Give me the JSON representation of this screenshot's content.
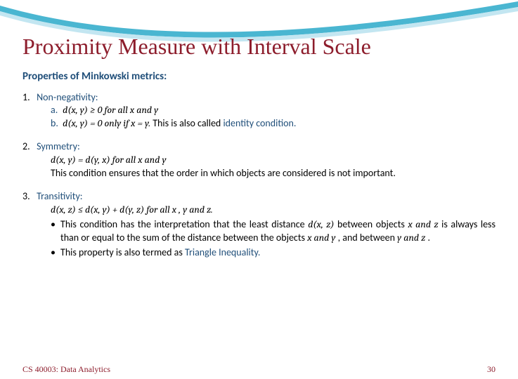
{
  "title": "Proximity Measure with Interval Scale",
  "section_head": "Properties of Minkowski metrics:",
  "items": [
    {
      "num": "1.",
      "name": "Non-negativity:",
      "subs": [
        {
          "label": "a.",
          "formula": "d(x, y) ≥ 0 for all x and y",
          "after": ""
        },
        {
          "label": "b.",
          "formula": "d(x, y) = 0 only if x = y.",
          "after": " This is also called ",
          "tail_blue": "identity condition.",
          "tail_plain": ""
        }
      ]
    },
    {
      "num": "2.",
      "name": "Symmetry:",
      "line_formula": "d(x, y) = d(y, x)  for all x and y",
      "line_text": "This condition ensures that the order in which objects are considered is not important."
    },
    {
      "num": "3.",
      "name": "Transitivity:",
      "line_formula": "d(x, z) ≤ d(x, y) + d(y, z) for all x , y and z.",
      "bullets": [
        {
          "pre": "This condition has the interpretation that the least distance ",
          "mid_math": "d(x, z)",
          "post1": " between objects ",
          "m2": "x and z",
          "post2": " is always less than or equal to the sum of the distance between the objects ",
          "m3": "x and y",
          "post3": ", and between ",
          "m4": "y and z",
          "post4": "."
        },
        {
          "plain_pre": "This property is also termed as ",
          "blue": "Triangle Inequality.",
          "plain_post": ""
        }
      ]
    }
  ],
  "footer": {
    "left": "CS 40003: Data Analytics",
    "right": "30"
  }
}
